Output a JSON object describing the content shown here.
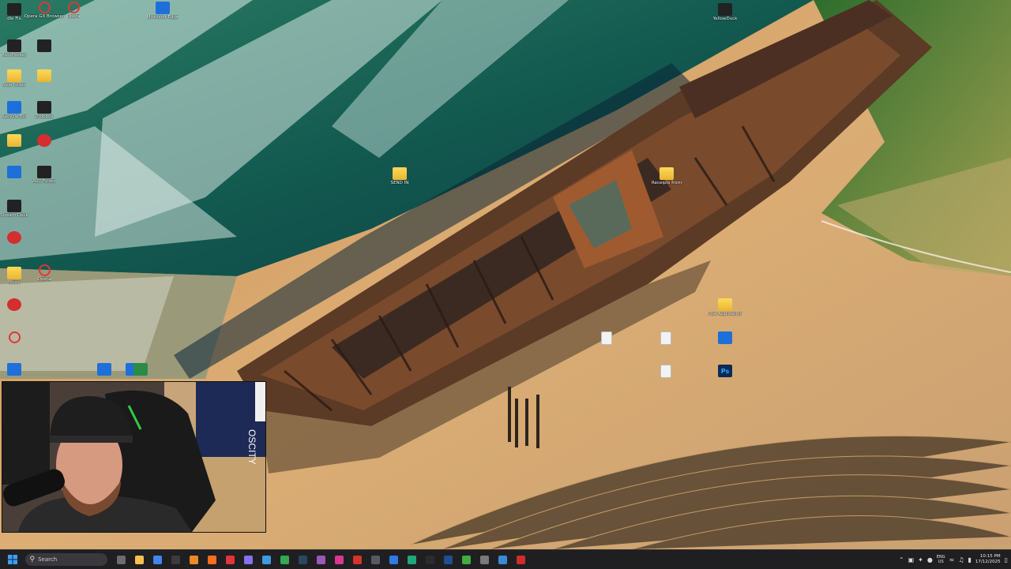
{
  "desktop": {
    "icons": [
      {
        "name": "top-left-app",
        "label": "dle Fix",
        "kind": "dark"
      },
      {
        "name": "opera-1",
        "label": "Opera GX Browser",
        "kind": "ring"
      },
      {
        "name": "opera-2",
        "label": "Opera",
        "kind": "ring"
      },
      {
        "name": "edge",
        "label": "Microsoft Edge",
        "kind": "blue"
      },
      {
        "name": "yellowduck",
        "label": "YellowDuck",
        "kind": "dark"
      },
      {
        "name": "autohotkey",
        "label": "AutoHotkey",
        "kind": "dark"
      },
      {
        "name": "file-1",
        "label": "",
        "kind": "dark"
      },
      {
        "name": "new-folder",
        "label": "New folder",
        "kind": "folder"
      },
      {
        "name": "folder-2",
        "label": "",
        "kind": "folder"
      },
      {
        "name": "recycle-bin",
        "label": "Recycle Bin",
        "kind": "blue"
      },
      {
        "name": "dropbox",
        "label": "Dropbox",
        "kind": "dark"
      },
      {
        "name": "folder-3",
        "label": "",
        "kind": "folder"
      },
      {
        "name": "app-red",
        "label": "",
        "kind": "red"
      },
      {
        "name": "app-4",
        "label": "",
        "kind": "blue"
      },
      {
        "name": "app-5",
        "label": "ARC Folder",
        "kind": "dark"
      },
      {
        "name": "streamdeck",
        "label": "Stream Deck",
        "kind": "dark"
      },
      {
        "name": "razer",
        "label": "",
        "kind": "red"
      },
      {
        "name": "opera-3",
        "label": "Opera",
        "kind": "ring"
      },
      {
        "name": "folder-music",
        "label": "Music",
        "kind": "folder"
      },
      {
        "name": "app-6",
        "label": "",
        "kind": "red"
      },
      {
        "name": "opera-4",
        "label": "",
        "kind": "ring"
      },
      {
        "name": "app-7",
        "label": "",
        "kind": "blue"
      },
      {
        "name": "send-folder",
        "label": "SEND IN",
        "kind": "folder"
      },
      {
        "name": "receipts-folder",
        "label": "Receipts from",
        "kind": "folder"
      },
      {
        "name": "visa-folder",
        "label": "Visa Application",
        "kind": "folder"
      },
      {
        "name": "doc-1",
        "label": "",
        "kind": "doc"
      },
      {
        "name": "doc-2",
        "label": "",
        "kind": "doc"
      },
      {
        "name": "app-8",
        "label": "",
        "kind": "blue"
      },
      {
        "name": "doc-3",
        "label": "",
        "kind": "doc"
      },
      {
        "name": "ps-file",
        "label": "",
        "kind": "ps"
      },
      {
        "name": "bottom-1",
        "label": "",
        "kind": "blue"
      },
      {
        "name": "bottom-2",
        "label": "",
        "kind": "blue"
      },
      {
        "name": "bottom-3",
        "label": "",
        "kind": "green"
      }
    ]
  },
  "taskbar": {
    "search_placeholder": "Search",
    "apps": [
      {
        "name": "task-view",
        "color": "#6b6b70"
      },
      {
        "name": "file-explorer",
        "color": "#f2c14e"
      },
      {
        "name": "chrome",
        "color": "#4285f4"
      },
      {
        "name": "obs",
        "color": "#3b3b3b"
      },
      {
        "name": "vlc",
        "color": "#f08a24"
      },
      {
        "name": "firefox",
        "color": "#ff6f1f"
      },
      {
        "name": "opera",
        "color": "#e3343a"
      },
      {
        "name": "premiere",
        "color": "#8b6ff0"
      },
      {
        "name": "capture",
        "color": "#3f9ae0"
      },
      {
        "name": "chrome-2",
        "color": "#34a853"
      },
      {
        "name": "steam",
        "color": "#2a475e"
      },
      {
        "name": "app-purple",
        "color": "#9b59b6"
      },
      {
        "name": "app-pink",
        "color": "#d6398f"
      },
      {
        "name": "app-red",
        "color": "#d9302c"
      },
      {
        "name": "app-grey",
        "color": "#555a66"
      },
      {
        "name": "app-blue",
        "color": "#2f7ae5"
      },
      {
        "name": "app-teal",
        "color": "#1fa67a"
      },
      {
        "name": "app-dark",
        "color": "#2b2b2b"
      },
      {
        "name": "app-navy",
        "color": "#1d4f91"
      },
      {
        "name": "app-green",
        "color": "#3fae3f"
      },
      {
        "name": "app-gear",
        "color": "#7a7a7a"
      },
      {
        "name": "app-send",
        "color": "#3a8bd6"
      },
      {
        "name": "app-record",
        "color": "#d12b2b"
      }
    ],
    "tray": {
      "lang_top": "ENG",
      "lang_bottom": "US",
      "time": "10:15 PM",
      "date": "17/12/2025"
    }
  },
  "colors": {
    "taskbar": "#1f1f22",
    "sand": "#d9a86a",
    "ocean": "#1e6b5a"
  }
}
